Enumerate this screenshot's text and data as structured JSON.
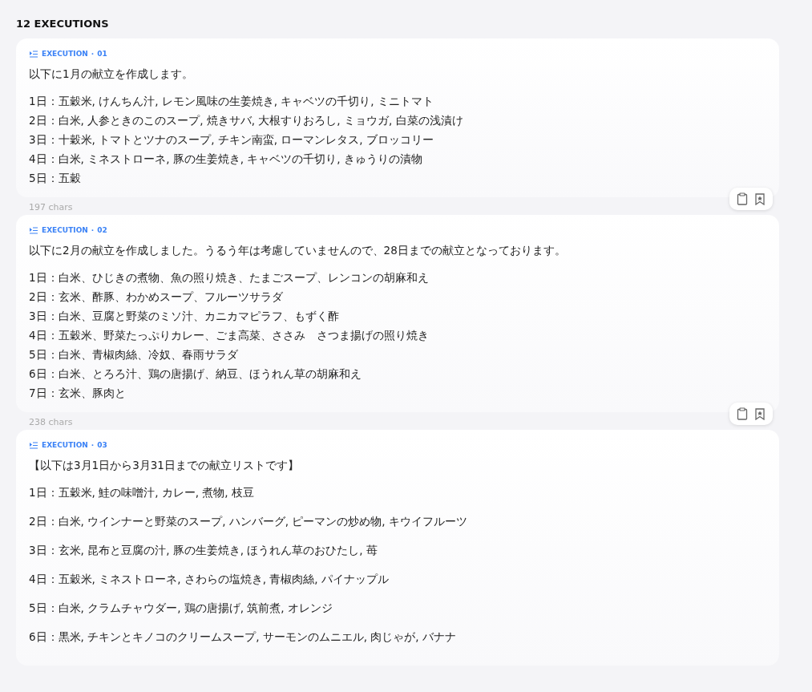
{
  "heading": "12 EXECUTIONS",
  "executions": [
    {
      "label": "EXECUTION",
      "separator": "·",
      "number": "01",
      "kind": "compact",
      "intro": "以下に1月の献立を作成します。",
      "lines": [
        "1日：五穀米, けんちん汁, レモン風味の生姜焼き, キャベツの千切り, ミニトマト",
        "2日：白米, 人参ときのこのスープ, 焼きサバ, 大根すりおろし, ミョウガ, 白菜の浅漬け",
        "3日：十穀米, トマトとツナのスープ, チキン南蛮, ローマンレタス, ブロッコリー",
        "4日：白米, ミネストローネ, 豚の生姜焼き, キャベツの千切り, きゅうりの漬物",
        "5日：五穀"
      ],
      "chars": "197 chars"
    },
    {
      "label": "EXECUTION",
      "separator": "·",
      "number": "02",
      "kind": "compact",
      "intro": "以下に2月の献立を作成しました。うるう年は考慮していませんので、28日までの献立となっております。",
      "lines": [
        "1日：白米、ひじきの煮物、魚の照り焼き、たまごスープ、レンコンの胡麻和え",
        "2日：玄米、酢豚、わかめスープ、フルーツサラダ",
        "3日：白米、豆腐と野菜のミソ汁、カニカマピラフ、もずく酢",
        "4日：五穀米、野菜たっぷりカレー、ごま高菜、ささみ　さつま揚げの照り焼き",
        "5日：白米、青椒肉絲、冷奴、春雨サラダ",
        "6日：白米、とろろ汁、鶏の唐揚げ、納豆、ほうれん草の胡麻和え",
        "7日：玄米、豚肉と"
      ],
      "chars": "238 chars"
    },
    {
      "label": "EXECUTION",
      "separator": "·",
      "number": "03",
      "kind": "spaced",
      "intro": "【以下は3月1日から3月31日までの献立リストです】",
      "lines": [
        "1日：五穀米, 鮭の味噌汁, カレー, 煮物, 枝豆",
        "2日：白米, ウインナーと野菜のスープ, ハンバーグ, ピーマンの炒め物, キウイフルーツ",
        "3日：玄米, 昆布と豆腐の汁, 豚の生姜焼き, ほうれん草のおひたし, 苺",
        "4日：五穀米, ミネストローネ, さわらの塩焼き, 青椒肉絲, パイナップル",
        "5日：白米, クラムチャウダー, 鶏の唐揚げ, 筑前煮, オレンジ",
        "6日：黒米, チキンとキノコのクリームスープ, サーモンのムニエル, 肉じゃが, バナナ"
      ]
    }
  ]
}
